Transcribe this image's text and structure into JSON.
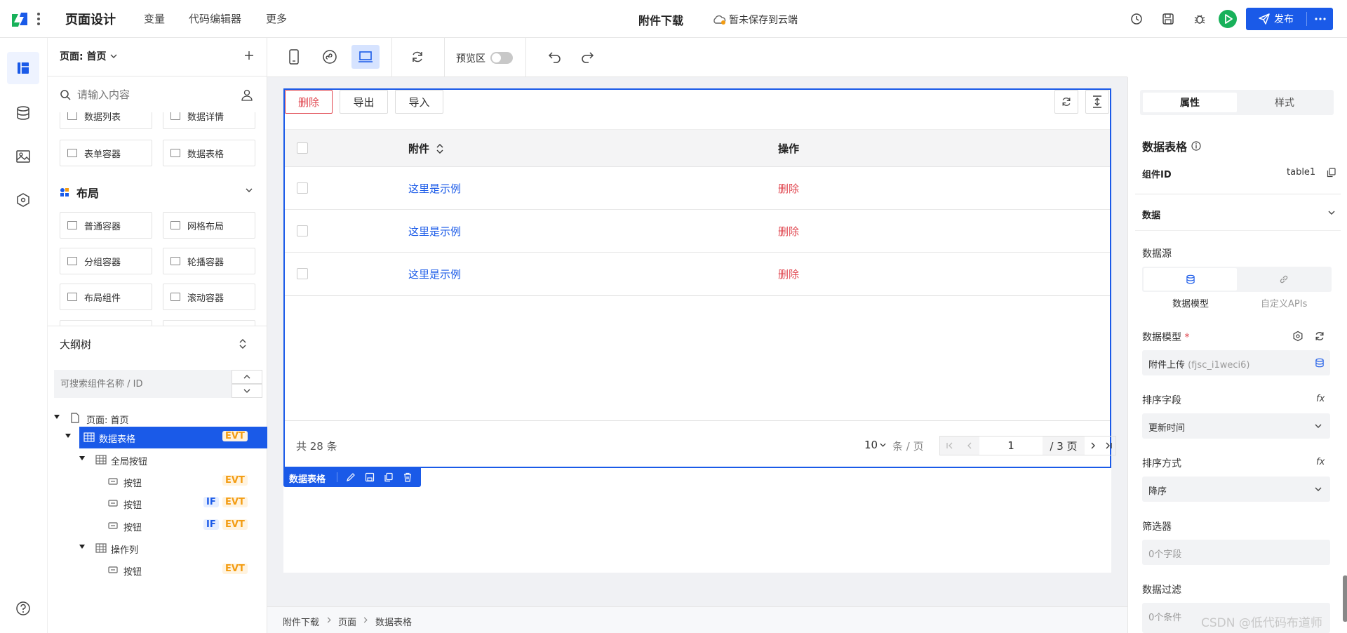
{
  "topbar": {
    "brand": "页面设计",
    "menu": [
      "变量",
      "代码编辑器",
      "更多"
    ],
    "doc_title": "附件下载",
    "save_status": "暂未保存到云端",
    "publish_label": "发布"
  },
  "component_panel": {
    "page_selector": "页面: 首页",
    "search_placeholder": "请输入内容",
    "data_items": [
      "数据列表",
      "数据详情",
      "表单容器",
      "数据表格"
    ],
    "layout_section_title": "布局",
    "layout_items": [
      "普通容器",
      "网格布局",
      "分组容器",
      "轮播容器",
      "布局组件",
      "滚动容器"
    ]
  },
  "outline": {
    "title": "大纲树",
    "search_placeholder": "可搜索组件名称 / ID",
    "nodes": [
      {
        "label": "页面: 首页"
      },
      {
        "label": "数据表格",
        "badge": "EVT"
      },
      {
        "label": "全局按钮"
      },
      {
        "label": "按钮",
        "badge": "EVT"
      },
      {
        "label": "按钮",
        "if": "IF",
        "badge": "EVT"
      },
      {
        "label": "按钮",
        "if": "IF",
        "badge": "EVT"
      },
      {
        "label": "操作列"
      },
      {
        "label": "按钮",
        "badge": "EVT"
      }
    ]
  },
  "toolbar": {
    "preview_label": "预览区"
  },
  "table": {
    "buttons": [
      "删除",
      "导出",
      "导入"
    ],
    "headers": [
      "附件",
      "操作"
    ],
    "rows": [
      {
        "attachment": "这里是示例",
        "action": "删除"
      },
      {
        "attachment": "这里是示例",
        "action": "删除"
      },
      {
        "attachment": "这里是示例",
        "action": "删除"
      }
    ],
    "pagination": {
      "total": "共 28 条",
      "page_size": "10",
      "per_page_label": "条 / 页",
      "current_page": "1",
      "total_pages": "/ 3 页"
    },
    "selection_tag": "数据表格"
  },
  "breadcrumb": [
    "附件下载",
    "页面",
    "数据表格"
  ],
  "props": {
    "tabs": [
      "属性",
      "样式"
    ],
    "title": "数据表格",
    "component_id_label": "组件ID",
    "component_id": "table1",
    "section_data": "数据",
    "datasource_label": "数据源",
    "datasource_options": [
      "数据模型",
      "自定义APIs"
    ],
    "model_label": "数据模型",
    "model_value": "附件上传",
    "model_value_id": "(fjsc_i1weci6)",
    "sort_field_label": "排序字段",
    "sort_field_value": "更新时间",
    "sort_order_label": "排序方式",
    "sort_order_value": "降序",
    "filter_label": "筛选器",
    "filter_value": "0个字段",
    "data_filter_label": "数据过滤",
    "data_filter_value": "0个条件",
    "fx": "fx"
  },
  "watermark": "CSDN @低代码布道师",
  "colors": {
    "primary": "#1a5ae8",
    "danger": "#e0454e",
    "evt": "#f39c12",
    "run": "#18b15a"
  }
}
